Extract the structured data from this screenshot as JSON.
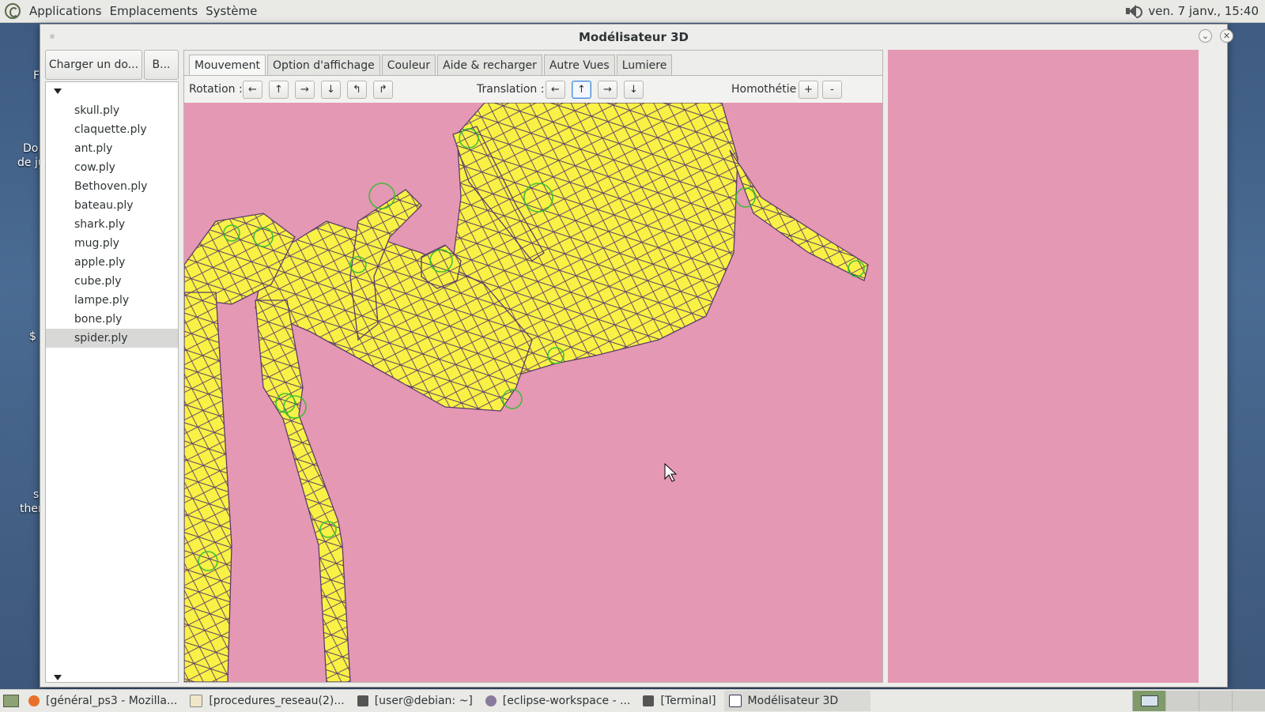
{
  "top_panel": {
    "menus": [
      "Applications",
      "Emplacements",
      "Système"
    ],
    "clock": "ven. 7 janv., 15:40"
  },
  "desktop_fragments": [
    "F",
    "Do",
    "de ju",
    "$",
    "s",
    "ther"
  ],
  "window": {
    "title": "Modélisateur 3D",
    "sidebar": {
      "load_button": "Charger un do...",
      "b_button": "B...",
      "files": [
        "skull.ply",
        "claquette.ply",
        "ant.ply",
        "cow.ply",
        "Bethoven.ply",
        "bateau.ply",
        "shark.ply",
        "mug.ply",
        "apple.ply",
        "cube.ply",
        "lampe.ply",
        "bone.ply",
        "spider.ply"
      ],
      "selected_file": "spider.ply"
    },
    "tabs": [
      "Mouvement",
      "Option d'affichage",
      "Couleur",
      "Aide & recharger",
      "Autre Vues",
      "Lumiere"
    ],
    "active_tab": "Mouvement",
    "toolbar": {
      "rotation_label": "Rotation :",
      "rotation_buttons": [
        "←",
        "↑",
        "→",
        "↓",
        "↰",
        "↱"
      ],
      "translation_label": "Translation :",
      "translation_buttons": [
        "←",
        "↑",
        "→",
        "↓"
      ],
      "homothetie_label": "Homothétie :",
      "homothetie_buttons": [
        "+",
        "-"
      ]
    },
    "viewport_bg": "#e598b3",
    "mesh_fill": "#f9f145",
    "mesh_edge": "#5a3d6b",
    "vertex_color": "#2fbf2f"
  },
  "taskbar": {
    "tasks": [
      "[général_ps3 - Mozilla...",
      "[procedures_reseau(2)...",
      "[user@debian: ~]",
      "[eclipse-workspace - ...",
      "[Terminal]",
      "Modélisateur 3D"
    ],
    "active_task": "Modélisateur 3D"
  }
}
